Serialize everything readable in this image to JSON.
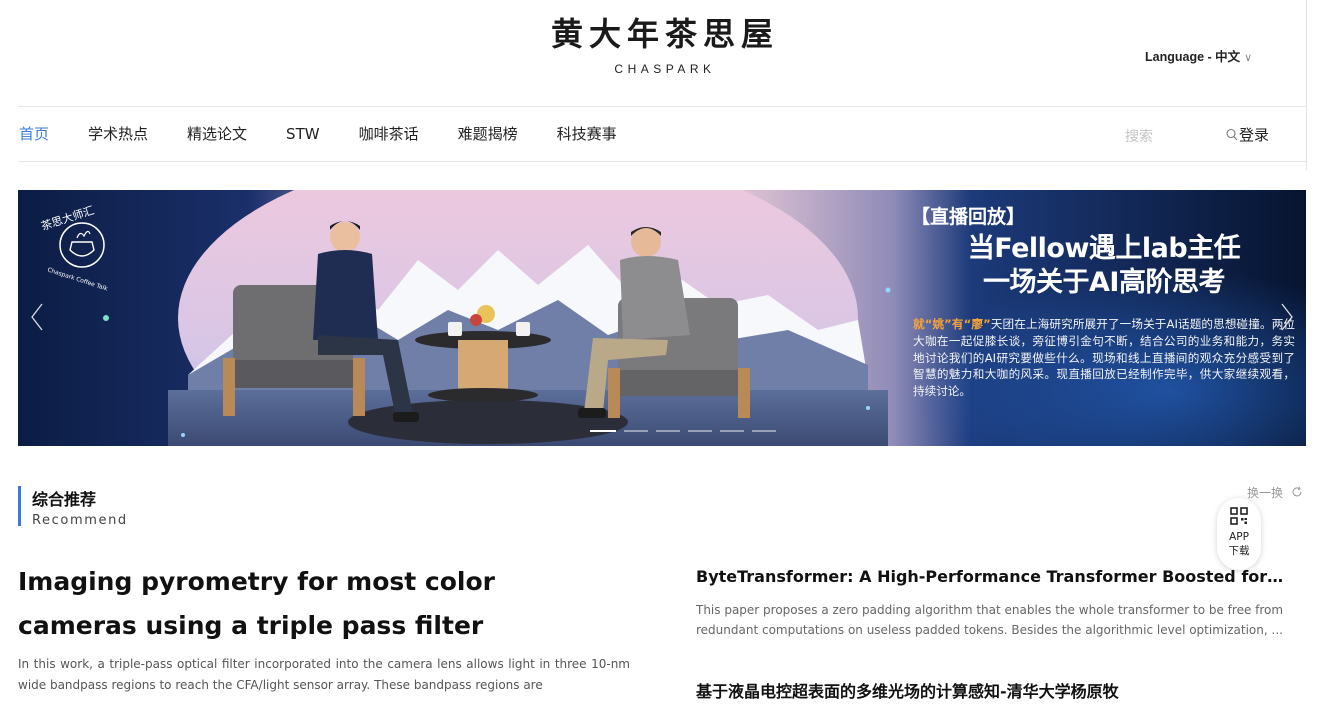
{
  "header": {
    "logo_cn": "黄大年茶思屋",
    "logo_en": "CHASPARK",
    "language_label": "Language - 中文",
    "language_chevron": "∨"
  },
  "nav": {
    "items": [
      {
        "label": "首页",
        "active": true
      },
      {
        "label": "学术热点"
      },
      {
        "label": "精选论文"
      },
      {
        "label": "STW"
      },
      {
        "label": "咖啡茶话"
      },
      {
        "label": "难题揭榜"
      },
      {
        "label": "科技赛事"
      }
    ],
    "search_placeholder": "搜索",
    "search_icon": "search-icon",
    "login_label": "登录"
  },
  "banner": {
    "tag": "【直播回放】",
    "line1": "当Fellow遇上lab主任",
    "line2": "一场关于AI高阶思考",
    "desc_highlight": "就“姚”有“廖”",
    "desc": "天团在上海研究所展开了一场关于AI话题的思想碰撞。两位大咖在一起促膝长谈，旁征博引金句不断，结合公司的业务和能力，务实地讨论我们的AI研究要做些什么。现场和线上直播间的观众充分感受到了智慧的魅力和大咖的风采。现直播回放已经制作完毕，供大家继续观看，持续讨论。",
    "emblem_text": "茶思大师汇",
    "emblem_sub": "Chaspark Coffee Talk",
    "slide_count": 6,
    "active_slide": 1,
    "accent_color": "#f5a43a"
  },
  "recommend": {
    "title": "综合推荐",
    "subtitle": "Recommend",
    "refresh_label": "换一换",
    "app_label_line1": "APP",
    "app_label_line2": "下载",
    "featured": {
      "title": "Imaging pyrometry for most color cameras using a triple pass filter",
      "desc": "In this work, a triple-pass optical filter incorporated into the camera lens allows light in three 10-nm wide bandpass regions to reach the CFA/light sensor array. These bandpass regions are"
    },
    "items": [
      {
        "title": "ByteTransformer: A High-Performance Transformer Boosted for Variable-Length Inputs",
        "desc": "This paper proposes a zero padding algorithm that enables the whole transformer to be free from redundant computations on useless padded tokens. Besides the algorithmic level optimization, ..."
      },
      {
        "title": "基于液晶电控超表面的多维光场的计算感知-清华大学杨原牧",
        "desc": ""
      }
    ]
  },
  "colors": {
    "accent": "#3a7ad9",
    "banner_bg": "#0a1a3a"
  }
}
